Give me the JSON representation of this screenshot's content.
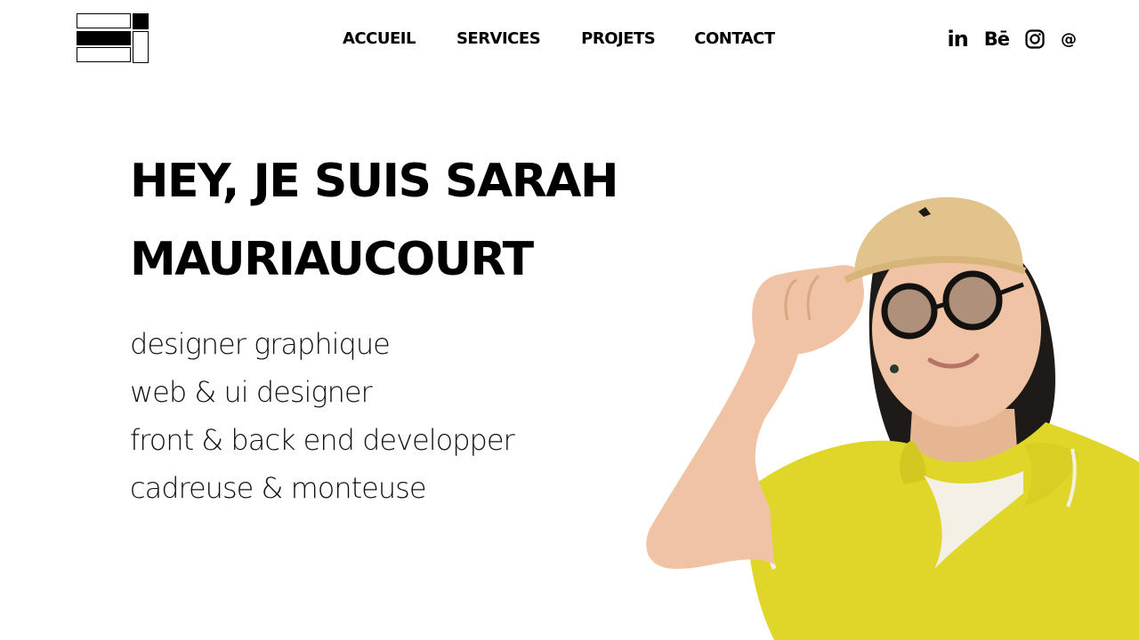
{
  "nav": {
    "items": [
      "ACCUEIL",
      "SERVICES",
      "PROJETS",
      "CONTACT"
    ]
  },
  "social": {
    "linkedin": "in",
    "behance": "Bē",
    "email": "@"
  },
  "hero": {
    "title_line1": "HEY, JE SUIS SARAH",
    "title_line2": "MAURIAUCOURT",
    "roles": [
      "designer graphique",
      "web & ui designer",
      "front & back end developper",
      "cadreuse & monteuse"
    ]
  },
  "colors": {
    "background": "#ffffff",
    "text": "#000000",
    "shirt": "#e0d62a",
    "cap": "#e2c38c",
    "skin": "#efc3a3",
    "hair": "#1d1a17"
  }
}
